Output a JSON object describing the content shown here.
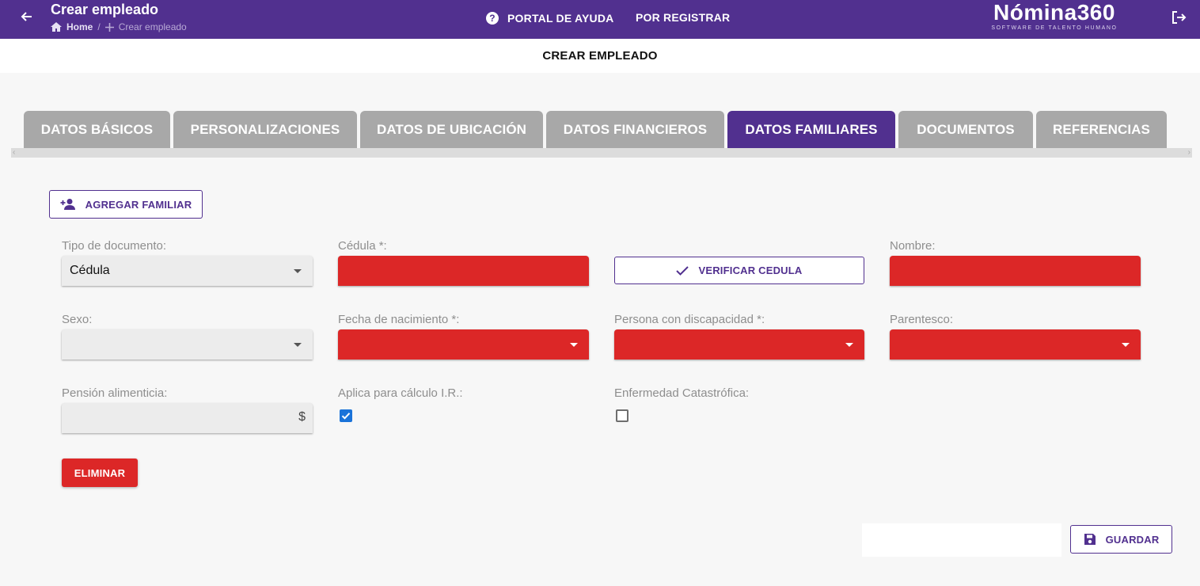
{
  "header": {
    "title": "Crear empleado",
    "breadcrumb": {
      "home": "Home",
      "separator": "/",
      "current": "Crear empleado"
    },
    "help_link": "PORTAL DE AYUDA",
    "register_link": "POR REGISTRAR",
    "logo": {
      "main": "Nómina360",
      "tagline": "SOFTWARE DE TALENTO HUMANO"
    },
    "icons": {
      "back": "arrow-left-icon",
      "home": "home-icon",
      "plus": "plus-icon",
      "help": "help-circle-icon",
      "logout": "logout-icon"
    },
    "background": "#51308f"
  },
  "subheader": {
    "title": "CREAR EMPLEADO"
  },
  "tabs": [
    {
      "label": "DATOS BÁSICOS",
      "active": false
    },
    {
      "label": "PERSONALIZACIONES",
      "active": false
    },
    {
      "label": "DATOS DE UBICACIÓN",
      "active": false
    },
    {
      "label": "DATOS FINANCIEROS",
      "active": false
    },
    {
      "label": "DATOS FAMILIARES",
      "active": true
    },
    {
      "label": "DOCUMENTOS",
      "active": false
    },
    {
      "label": "REFERENCIAS",
      "active": false
    }
  ],
  "tab_scroll": {
    "left_arrow": "‹",
    "right_arrow": "›"
  },
  "add_family_button": {
    "label": "AGREGAR FAMILIAR",
    "icon": "person-add-icon"
  },
  "form": {
    "tipo_documento": {
      "label": "Tipo de documento:",
      "value": "Cédula",
      "error": false
    },
    "cedula": {
      "label": "Cédula *:",
      "value": "",
      "error": true
    },
    "verify_button": {
      "label": "VERIFICAR CEDULA",
      "icon": "check-icon"
    },
    "nombre": {
      "label": "Nombre:",
      "value": "",
      "error": true
    },
    "sexo": {
      "label": "Sexo:",
      "value": "",
      "error": false
    },
    "fecha_nacimiento": {
      "label": "Fecha de nacimiento *:",
      "value": "",
      "error": true
    },
    "discapacidad": {
      "label": "Persona con discapacidad *:",
      "value": "",
      "error": true
    },
    "parentesco": {
      "label": "Parentesco:",
      "value": "",
      "error": true
    },
    "pension": {
      "label": "Pensión alimenticia:",
      "value": "",
      "suffix": "$"
    },
    "calculo_ir": {
      "label": "Aplica para cálculo I.R.:",
      "checked": true
    },
    "enfermedad": {
      "label": "Enfermedad Catastrófica:",
      "checked": false
    }
  },
  "delete_button": {
    "label": "ELIMINAR"
  },
  "save_button": {
    "label": "GUARDAR",
    "icon": "save-icon"
  },
  "colors": {
    "accent": "#51308f",
    "error": "#dc2727",
    "tab_inactive": "#a8a8a8",
    "checkbox": "#1a73d9"
  }
}
